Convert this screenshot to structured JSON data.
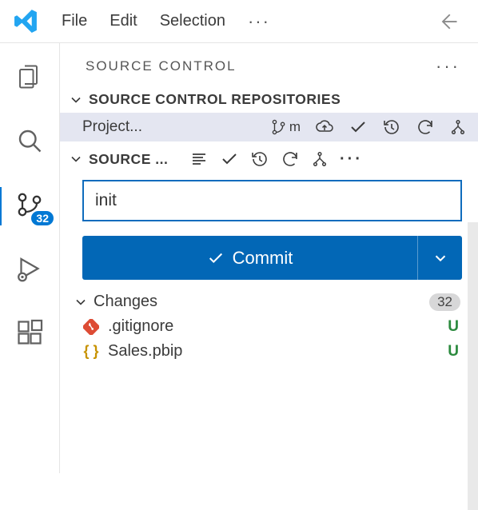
{
  "menu": {
    "file": "File",
    "edit": "Edit",
    "selection": "Selection",
    "more": "···"
  },
  "panel": {
    "title": "SOURCE CONTROL",
    "more": "···",
    "repos_section_label": "SOURCE CONTROL REPOSITORIES",
    "repo_name": "Project...",
    "branch_hint": "m",
    "sc_section_label": "SOURCE ...",
    "sc_more": "···",
    "commit_value": "init",
    "commit_button": "Commit",
    "changes_label": "Changes",
    "changes_count": "32",
    "files": [
      {
        "name": ".gitignore",
        "status": "U",
        "icon": "git"
      },
      {
        "name": "Sales.pbip",
        "status": "U",
        "icon": "braces"
      }
    ]
  },
  "activity": {
    "scm_badge": "32"
  }
}
